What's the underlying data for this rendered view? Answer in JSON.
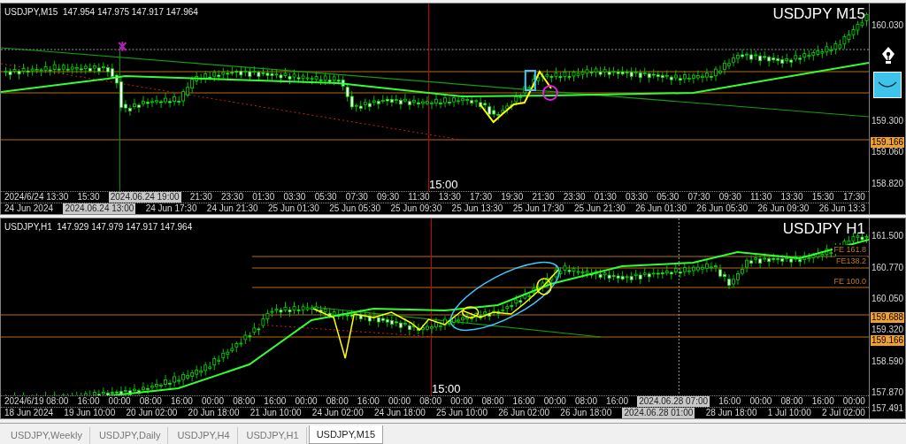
{
  "charts": [
    {
      "symbol_info": "USDJPY,M15  147.954 147.975 147.917 147.964",
      "title": "USDJPY M15",
      "cursor_time": "15:00",
      "price_labels": [
        {
          "text": "160.030",
          "highlighted": false
        },
        {
          "text": "159.300",
          "highlighted": false
        },
        {
          "text": "159.166",
          "highlighted": true
        },
        {
          "text": "159.060",
          "highlighted": false
        },
        {
          "text": "158.820",
          "highlighted": false
        }
      ],
      "time_row_1": [
        {
          "text": "2024/6/24 13:30",
          "highlighted": false
        },
        {
          "text": "15:30",
          "highlighted": false
        },
        {
          "text": "2024.06.24 19:00",
          "highlighted": true
        },
        {
          "text": "21:30",
          "highlighted": false
        },
        {
          "text": "23:30",
          "highlighted": false
        },
        {
          "text": "01:30",
          "highlighted": false
        },
        {
          "text": "03:30",
          "highlighted": false
        },
        {
          "text": "05:30",
          "highlighted": false
        },
        {
          "text": "07:30",
          "highlighted": false
        },
        {
          "text": "09:30",
          "highlighted": false
        },
        {
          "text": "11:30",
          "highlighted": false
        },
        {
          "text": "13:30",
          "highlighted": false
        },
        {
          "text": "17:30",
          "highlighted": false
        },
        {
          "text": "19:30",
          "highlighted": false
        },
        {
          "text": "21:30",
          "highlighted": false
        },
        {
          "text": "23:30",
          "highlighted": false
        },
        {
          "text": "01:30",
          "highlighted": false
        },
        {
          "text": "03:30",
          "highlighted": false
        },
        {
          "text": "05:30",
          "highlighted": false
        },
        {
          "text": "07:30",
          "highlighted": false
        },
        {
          "text": "09:30",
          "highlighted": false
        },
        {
          "text": "11:30",
          "highlighted": false
        },
        {
          "text": "13:30",
          "highlighted": false
        },
        {
          "text": "15:30",
          "highlighted": false
        },
        {
          "text": "17:30",
          "highlighted": false
        }
      ],
      "time_row_2": [
        {
          "text": "24 Jun 2024",
          "highlighted": false
        },
        {
          "text": "2024.06.24 13:00",
          "highlighted": true
        },
        {
          "text": "24 Jun 17:30",
          "highlighted": false
        },
        {
          "text": "24 Jun 21:30",
          "highlighted": false
        },
        {
          "text": "25 Jun 01:30",
          "highlighted": false
        },
        {
          "text": "25 Jun 05:30",
          "highlighted": false
        },
        {
          "text": "25 Jun 09:30",
          "highlighted": false
        },
        {
          "text": "25 Jun 13:30",
          "highlighted": false
        },
        {
          "text": "25 Jun 17:30",
          "highlighted": false
        },
        {
          "text": "25 Jun 21:30",
          "highlighted": false
        },
        {
          "text": "26 Jun 01:30",
          "highlighted": false
        },
        {
          "text": "26 Jun 05:30",
          "highlighted": false
        },
        {
          "text": "26 Jun 09:30",
          "highlighted": false
        },
        {
          "text": "26 Jun 13:3",
          "highlighted": false
        }
      ]
    },
    {
      "symbol_info": "USDJPY,H1  147.929 147.979 147.917 147.964",
      "title": "USDJPY H1",
      "cursor_time": "15:00",
      "price_labels": [
        {
          "text": "161.500",
          "highlighted": false
        },
        {
          "text": "160.770",
          "highlighted": false
        },
        {
          "text": "160.050",
          "highlighted": false
        },
        {
          "text": "159.688",
          "highlighted": true
        },
        {
          "text": "159.320",
          "highlighted": false
        },
        {
          "text": "159.166",
          "highlighted": true
        },
        {
          "text": "158.590",
          "highlighted": false
        },
        {
          "text": "157.870",
          "highlighted": false
        },
        {
          "text": "157.491",
          "highlighted": false
        }
      ],
      "fibonacci_labels": [
        "FE 161.8",
        "FE138.2",
        "FE 100.0"
      ],
      "time_row_1": [
        {
          "text": "2024/6/19 08:00",
          "highlighted": false
        },
        {
          "text": "16:00",
          "highlighted": false
        },
        {
          "text": "00:00",
          "highlighted": false
        },
        {
          "text": "08:00",
          "highlighted": false
        },
        {
          "text": "16:00",
          "highlighted": false
        },
        {
          "text": "00:00",
          "highlighted": false
        },
        {
          "text": "08:00",
          "highlighted": false
        },
        {
          "text": "16:00",
          "highlighted": false
        },
        {
          "text": "00:00",
          "highlighted": false
        },
        {
          "text": "08:00",
          "highlighted": false
        },
        {
          "text": "16:00",
          "highlighted": false
        },
        {
          "text": "00:00",
          "highlighted": false
        },
        {
          "text": "08:00",
          "highlighted": false
        },
        {
          "text": "00:00",
          "highlighted": false
        },
        {
          "text": "08:00",
          "highlighted": false
        },
        {
          "text": "16:00",
          "highlighted": false
        },
        {
          "text": "00:00",
          "highlighted": false
        },
        {
          "text": "08:00",
          "highlighted": false
        },
        {
          "text": "16:00",
          "highlighted": false
        },
        {
          "text": "2024.06.28 07:00",
          "highlighted": true
        },
        {
          "text": "16:00",
          "highlighted": false
        },
        {
          "text": "00:00",
          "highlighted": false
        },
        {
          "text": "08:00",
          "highlighted": false
        },
        {
          "text": "16:00",
          "highlighted": false
        },
        {
          "text": "00:00",
          "highlighted": false
        }
      ],
      "time_row_2": [
        {
          "text": "18 Jun 2024",
          "highlighted": false
        },
        {
          "text": "19 Jun 10:00",
          "highlighted": false
        },
        {
          "text": "20 Jun 02:00",
          "highlighted": false
        },
        {
          "text": "20 Jun 18:00",
          "highlighted": false
        },
        {
          "text": "21 Jun 10:00",
          "highlighted": false
        },
        {
          "text": "24 Jun 02:00",
          "highlighted": false
        },
        {
          "text": "24 Jun 18:00",
          "highlighted": false
        },
        {
          "text": "25 Jun 10:00",
          "highlighted": false
        },
        {
          "text": "26 Jun 02:00",
          "highlighted": false
        },
        {
          "text": "26 Jun 18:00",
          "highlighted": false
        },
        {
          "text": "2024.06.28 01:00",
          "highlighted": true
        },
        {
          "text": "28 Jun 18:00",
          "highlighted": false
        },
        {
          "text": "1 Jul 10:00",
          "highlighted": false
        },
        {
          "text": "2 Jul 02:00",
          "highlighted": false
        }
      ]
    }
  ],
  "tabs": [
    {
      "label": "USDJPY,Weekly",
      "selected": false
    },
    {
      "label": "USDJPY,Daily",
      "selected": false
    },
    {
      "label": "USDJPY,H4",
      "selected": false
    },
    {
      "label": "USDJPY,H1",
      "selected": false
    },
    {
      "label": "USDJPY,M15",
      "selected": true
    }
  ]
}
